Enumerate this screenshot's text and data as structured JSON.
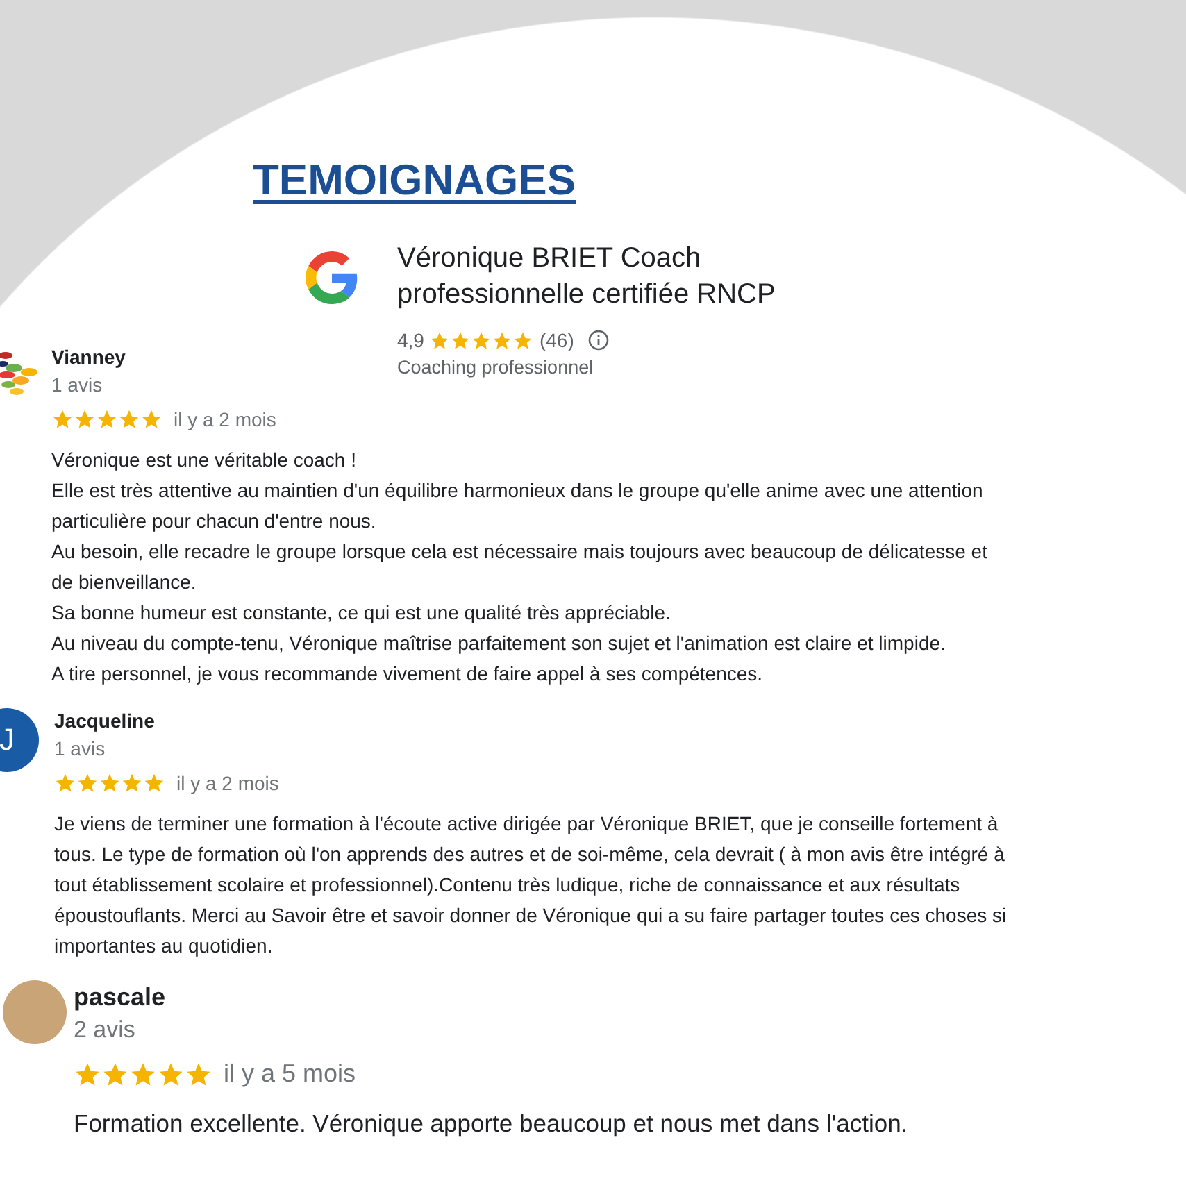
{
  "title": "TEMOIGNAGES",
  "business": {
    "name": "Véronique BRIET Coach professionnelle certifiée RNCP",
    "rating": "4,9",
    "stars": 5,
    "count": "(46)",
    "category": "Coaching professionnel"
  },
  "reviews": [
    {
      "kind": "logo",
      "name": "Vianney",
      "reviews_count": "1 avis",
      "stars": 5,
      "date": "il y a 2 mois",
      "paragraphs": [
        "Véronique est une véritable coach !",
        "Elle est très attentive au maintien d'un équilibre harmonieux dans le groupe qu'elle anime avec une attention particulière pour chacun d'entre nous.",
        "Au besoin, elle recadre le groupe lorsque cela est nécessaire mais toujours avec beaucoup de délicatesse et de bienveillance.",
        "Sa bonne humeur est constante, ce qui est une qualité très appréciable.",
        "Au niveau du compte-tenu, Véronique maîtrise parfaitement son sujet et l'animation est claire et limpide.",
        "A tire personnel, je vous recommande vivement de faire appel à ses compétences."
      ]
    },
    {
      "kind": "letter",
      "letter": "J",
      "name": "Jacqueline",
      "reviews_count": "1 avis",
      "stars": 5,
      "date": "il y a 2 mois",
      "paragraphs": [
        "Je viens de terminer une formation à l'écoute active dirigée par Véronique BRIET, que je conseille fortement à tous. Le type de formation où l'on apprends des autres et de soi-même, cela devrait ( à mon avis être intégré à tout établissement scolaire et professionnel).Contenu très ludique, riche de connaissance et aux résultats époustouflants. Merci au Savoir être et savoir donner de Véronique qui a su faire partager toutes ces choses si importantes au quotidien."
      ]
    },
    {
      "kind": "photo",
      "name": "pascale",
      "reviews_count": "2 avis",
      "stars": 5,
      "date": "il y a 5 mois",
      "paragraphs": [
        "Formation excellente. Véronique apporte beaucoup et nous met dans l'action."
      ]
    }
  ]
}
